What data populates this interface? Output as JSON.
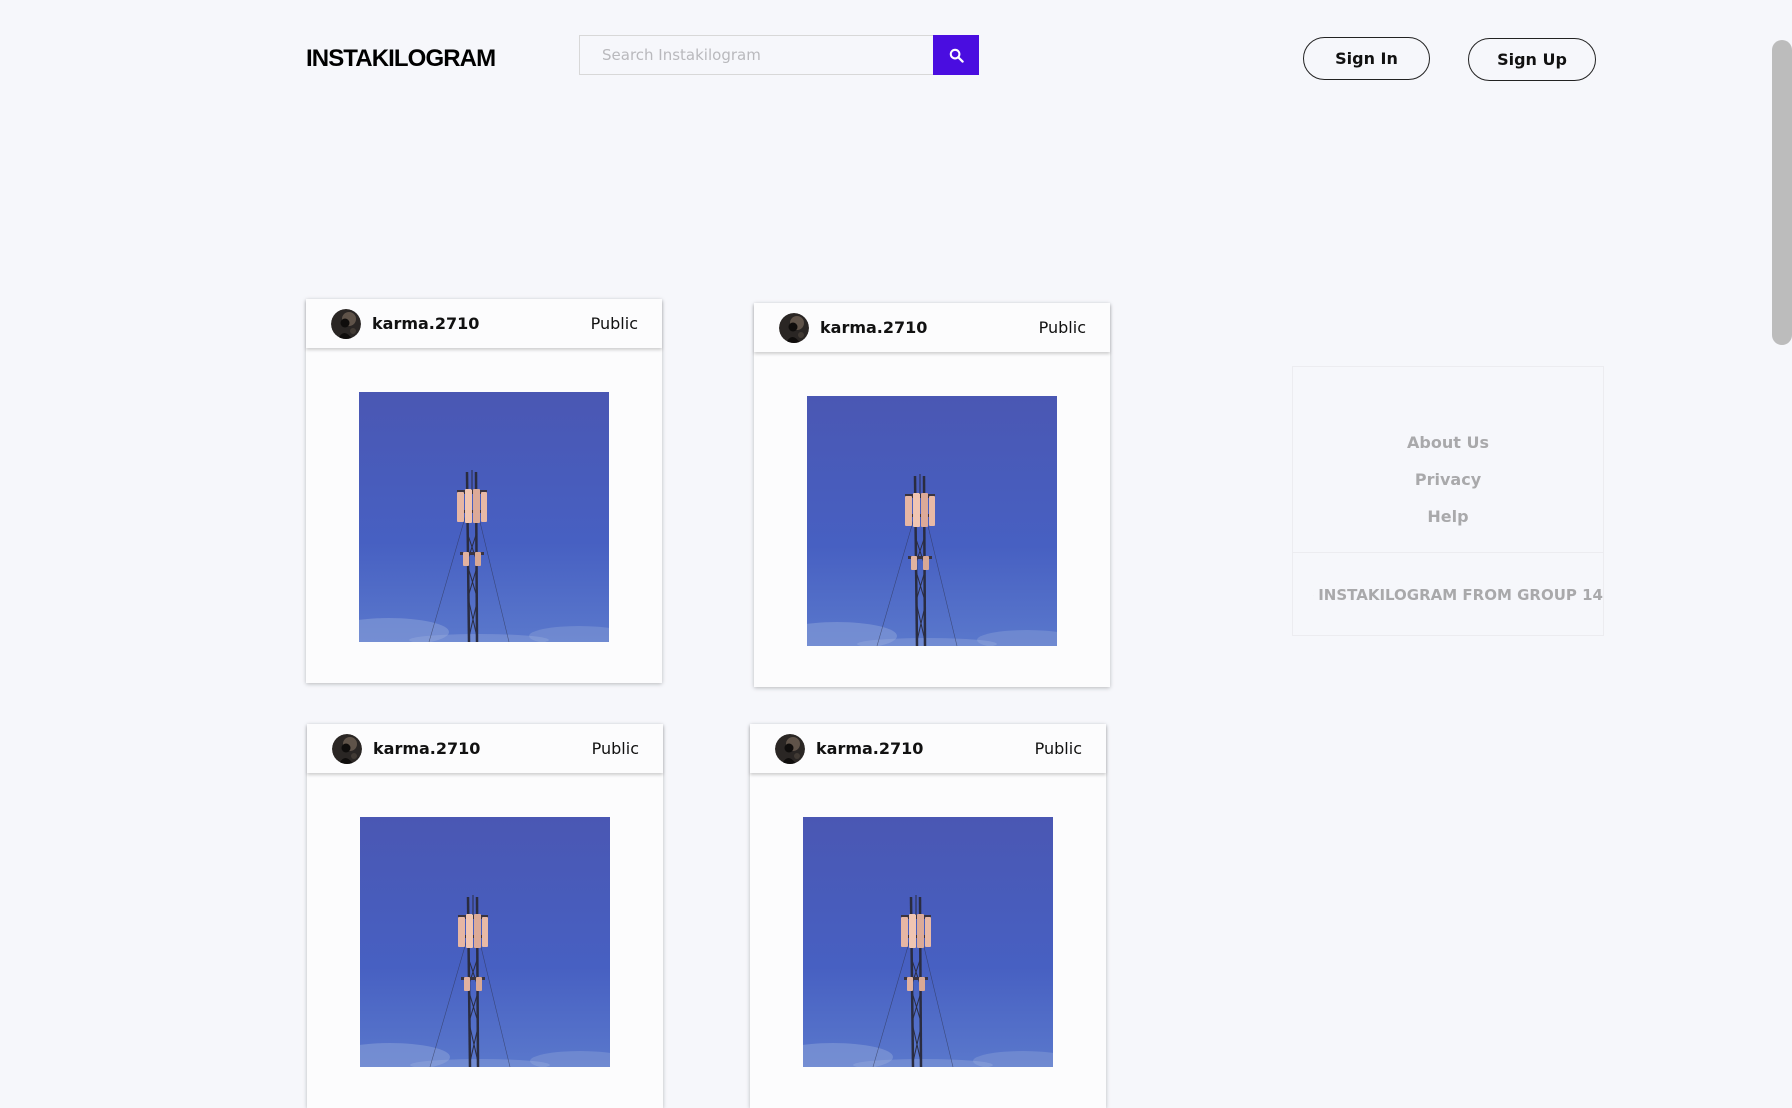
{
  "header": {
    "logo": "INSTAKILOGRAM",
    "search_placeholder": "Search Instakilogram",
    "search_icon": "search-icon",
    "sign_in_label": "Sign In",
    "sign_up_label": "Sign Up"
  },
  "colors": {
    "accent": "#4a0de0",
    "background": "#f6f7fb",
    "muted_text": "#a9a9ab",
    "sky": "#4a5cb8"
  },
  "posts": [
    {
      "username": "karma.2710",
      "visibility": "Public",
      "image": "cell-tower-photo"
    },
    {
      "username": "karma.2710",
      "visibility": "Public",
      "image": "cell-tower-photo"
    },
    {
      "username": "karma.2710",
      "visibility": "Public",
      "image": "cell-tower-photo"
    },
    {
      "username": "karma.2710",
      "visibility": "Public",
      "image": "cell-tower-photo"
    }
  ],
  "footer": {
    "links": [
      "About Us",
      "Privacy",
      "Help"
    ],
    "copyright_icon": "copyright-icon",
    "copyright": "INSTAKILOGRAM FROM GROUP 14"
  }
}
